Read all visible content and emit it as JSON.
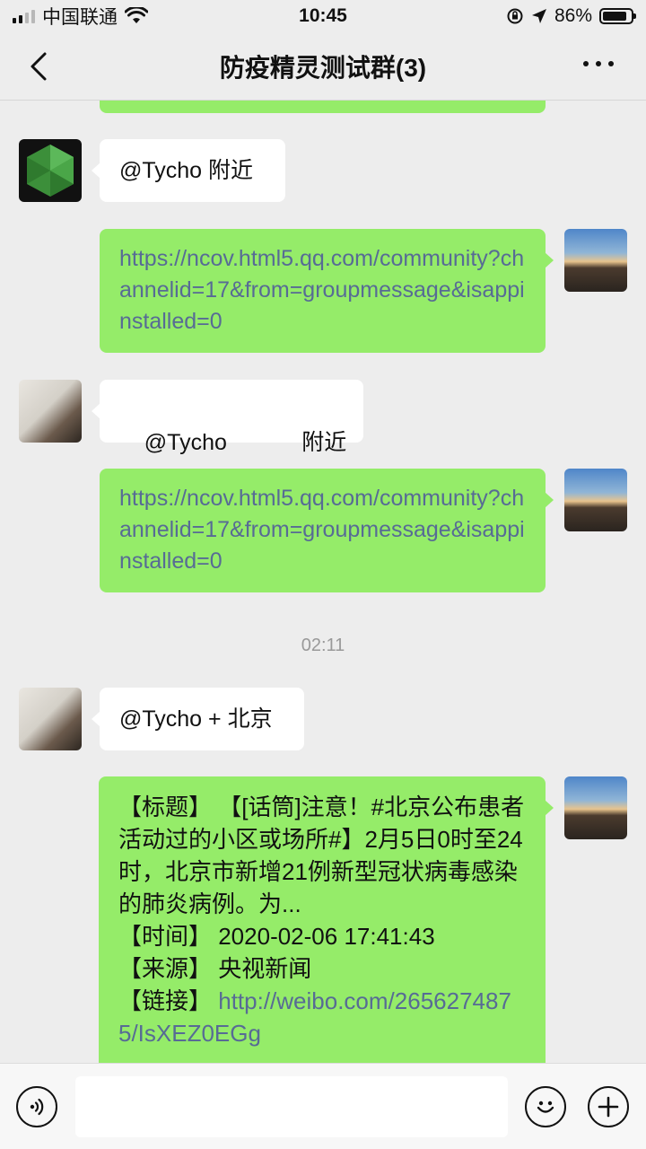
{
  "status_bar": {
    "carrier": "中国联通",
    "time": "10:45",
    "battery_percent": "86%",
    "battery_level": 0.86,
    "signal_bars": 4,
    "signal_active": 2
  },
  "nav": {
    "title": "防疫精灵测试群(3)",
    "back_icon": "chevron-left-icon",
    "more_icon": "ellipsis-icon"
  },
  "messages": [
    {
      "side": "left",
      "avatar": "node-logo-avatar",
      "text": "@Tycho 附近"
    },
    {
      "side": "right",
      "avatar": "sunset-avatar",
      "text": "https://ncov.html5.qq.com/community?channelid=17&from=groupmessage&isappinstalled=0",
      "is_link": true
    },
    {
      "side": "left",
      "avatar": "cat-avatar",
      "text": "@Tycho            附近"
    },
    {
      "side": "right",
      "avatar": "sunset-avatar",
      "text": "https://ncov.html5.qq.com/community?channelid=17&from=groupmessage&isappinstalled=0",
      "is_link": true
    },
    {
      "timestamp": "02:11"
    },
    {
      "side": "left",
      "avatar": "cat-avatar",
      "text": "@Tycho + 北京"
    },
    {
      "side": "right",
      "avatar": "sunset-avatar",
      "lines": [
        "【标题】 【[话筒]注意！#北京公布患者活动过的小区或场所#】2月5日0时至24时，北京市新增21例新型冠状病毒感染的肺炎病例。为...",
        "【时间】 2020-02-06 17:41:43",
        "【来源】 央视新闻"
      ],
      "link_label": "【链接】 ",
      "link": "http://weibo.com/2656274875/IsXEZ0EGg"
    }
  ],
  "input_bar": {
    "voice_icon": "voice-icon",
    "emoji_icon": "emoji-icon",
    "plus_icon": "plus-icon",
    "input_value": ""
  },
  "colors": {
    "background": "#ededed",
    "my_bubble": "#95ec69",
    "other_bubble": "#ffffff",
    "link": "#576b95"
  }
}
